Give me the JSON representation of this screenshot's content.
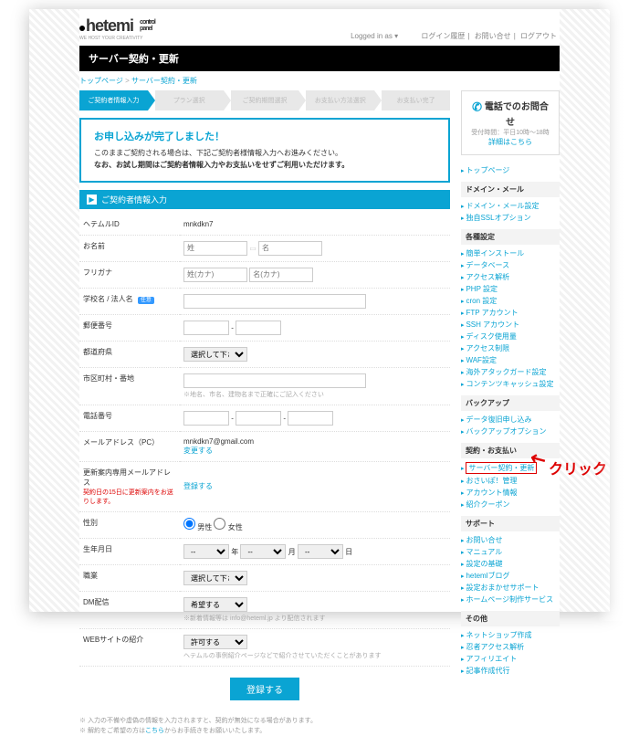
{
  "header": {
    "logo_main": "hetemi",
    "logo_sub1": "control",
    "logo_sub2": "panel",
    "logo_tag": "WE HOST YOUR CREATIVITY",
    "logged_in": "Logged in as",
    "links": {
      "guide": "ログイン履歴",
      "contact": "お問い合せ",
      "logout": "ログアウト"
    }
  },
  "title": "サーバー契約・更新",
  "breadcrumb": {
    "top": "トップページ",
    "sep": " > ",
    "cur": "サーバー契約・更新"
  },
  "steps": [
    "ご契約者情報入力",
    "プラン選択",
    "ご契約期間選択",
    "お支払い方法選択",
    "お支払い完了"
  ],
  "notice": {
    "title": "お申し込みが完了しました！",
    "l1": "このままご契約される場合は、下記ご契約者様情報入力へお進みください。",
    "l2": "なお、お試し期間はご契約者情報入力やお支払いをせずご利用いただけます。"
  },
  "section": "ご契約者情報入力",
  "fields": {
    "id_l": "ヘテムルID",
    "id_v": "mnkdkn7",
    "name_l": "お名前",
    "name_p1": "姓",
    "name_p2": "名",
    "kana_l": "フリガナ",
    "kana_p1": "姓(カナ)",
    "kana_p2": "名(カナ)",
    "corp_l": "学校名 / 法人名",
    "corp_b": "任意",
    "zip_l": "郵便番号",
    "pref_l": "都道府県",
    "pref_p": "選択して下さい",
    "addr_l": "市区町村・番地",
    "addr_h": "※地名、市名、建物名まで正確にご記入ください",
    "tel_l": "電話番号",
    "mail_l": "メールアドレス（PC）",
    "mail_v": "mnkdkn7@gmail.com",
    "mail_c": "変更する",
    "mail2_l": "更新案内専用メールアドレス",
    "mail2_h": "契約日の15日に更新案内をお送りします。",
    "mail2_c": "登録する",
    "sex_l": "性別",
    "sex_m": "男性",
    "sex_f": "女性",
    "bd_l": "生年月日",
    "bd_y": "年",
    "bd_m": "月",
    "bd_d": "日",
    "job_l": "職業",
    "job_p": "選択して下さい",
    "dm_l": "DM配信",
    "dm_p": "希望する",
    "dm_h": "※新着情報等は info@heteml.jp より配信されます",
    "web_l": "WEBサイトの紹介",
    "web_p": "許可する",
    "web_h": "ヘテムルの事例紹介ページなどで紹介させていただくことがあります"
  },
  "submit": "登録する",
  "footnotes": {
    "l1": "※ 入力の不備や虚偽の情報を入力されますと、契約が無効になる場合があります。",
    "l2a": "※ 解約をご希望の方は",
    "l2b": "こちら",
    "l2c": "からお手続きをお願いいたします。"
  },
  "side": {
    "tel_t": "電話でのお問合せ",
    "tel_h": "受付時間：平日10時〜18時",
    "tel_d": "詳細はこちら",
    "groups": {
      "top": {
        "items": [
          "トップページ"
        ]
      },
      "domain": {
        "h": "ドメイン・メール",
        "items": [
          "ドメイン・メール設定",
          "独自SSLオプション"
        ]
      },
      "settings": {
        "h": "各種設定",
        "items": [
          "簡単インストール",
          "データベース",
          "アクセス解析",
          "PHP 設定",
          "cron 設定",
          "FTP アカウント",
          "SSH アカウント",
          "ディスク使用量",
          "アクセス制限",
          "WAF設定",
          "海外アタックガード設定",
          "コンテンツキャッシュ設定"
        ]
      },
      "backup": {
        "h": "バックアップ",
        "items": [
          "データ復旧申し込み",
          "バックアップオプション"
        ]
      },
      "contract": {
        "h": "契約・お支払い",
        "items": [
          "サーバー契約・更新",
          "おさいぽ！管理",
          "アカウント情報",
          "紹介クーポン"
        ]
      },
      "support": {
        "h": "サポート",
        "items": [
          "お問い合せ",
          "マニュアル",
          "設定の基礎",
          "hetemlブログ",
          "設定おまかせサポート",
          "ホームページ制作サービス"
        ]
      },
      "other": {
        "h": "その他",
        "items": [
          "ネットショップ作成",
          "忍者アクセス解析",
          "アフィリエイト",
          "記事作成代行"
        ]
      }
    }
  },
  "callout": "クリック"
}
